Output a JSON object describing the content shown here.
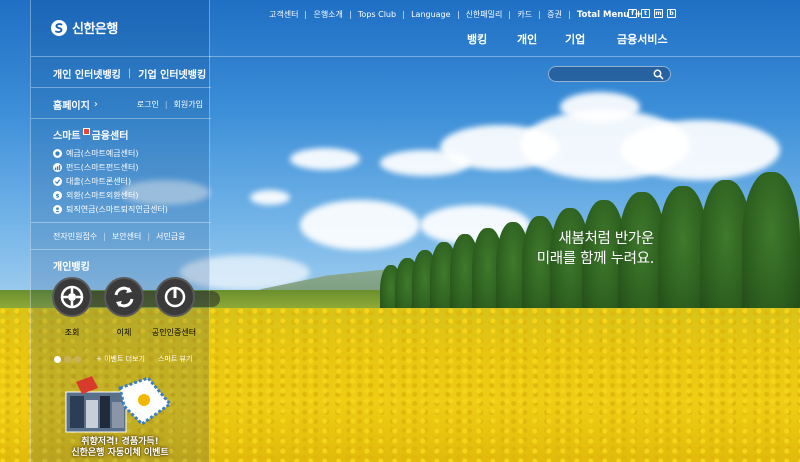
{
  "brand": {
    "name": "신한은행"
  },
  "utility_nav": {
    "items": [
      "고객센터",
      "은행소개",
      "Tops Club",
      "Language",
      "신한패밀리",
      "카드",
      "증권"
    ],
    "total_menu": "Total Menu",
    "total_menu_plus": "+"
  },
  "social": [
    "f",
    "t",
    "m",
    "b"
  ],
  "main_nav": [
    "뱅킹",
    "개인",
    "기업",
    "금융서비스"
  ],
  "search": {
    "placeholder": ""
  },
  "sidebar": {
    "personal_ib": "개인 인터넷뱅킹",
    "separator": "|",
    "corporate_ib": "기업 인터넷뱅킹",
    "homepage": "홈페이지",
    "homepage_chevron": "›",
    "login": "로그인",
    "join": "회원가입",
    "smart_center_title": "스마트",
    "smart_center_suffix": "금융센터",
    "smart_items": [
      {
        "label": "예금(스마트예금센터)",
        "icon": "deposit-icon"
      },
      {
        "label": "펀드(스마트펀드센터)",
        "icon": "fund-icon"
      },
      {
        "label": "대출(스마트론센터)",
        "icon": "loan-icon"
      },
      {
        "label": "외환(스마트외환센터)",
        "icon": "forex-icon"
      },
      {
        "label": "퇴직연금(스마트퇴직연금센터)",
        "icon": "pension-icon"
      }
    ],
    "links": [
      "전자민원접수",
      "보안센터",
      "서민금융"
    ],
    "personal_banking_title": "개인뱅킹",
    "quick_buttons": [
      {
        "label": "조회",
        "icon": "inquiry-icon"
      },
      {
        "label": "이체",
        "icon": "transfer-icon"
      },
      {
        "label": "공인인증센터",
        "icon": "certificate-icon"
      }
    ],
    "carousel_more": "+ 이벤트 더보기",
    "carousel_stop": "스마트 뷰기",
    "promo_line1": "취향저격! 경품가득!",
    "promo_line2": "신한은행 자동이체 이벤트"
  },
  "hero": {
    "headline_line1": "새봄처럼 반가운",
    "headline_line2": "미래를 함께 누려요."
  },
  "colors": {
    "sky": "#2e7fc9",
    "field": "#e8c610",
    "badge_red": "#e8463a"
  }
}
